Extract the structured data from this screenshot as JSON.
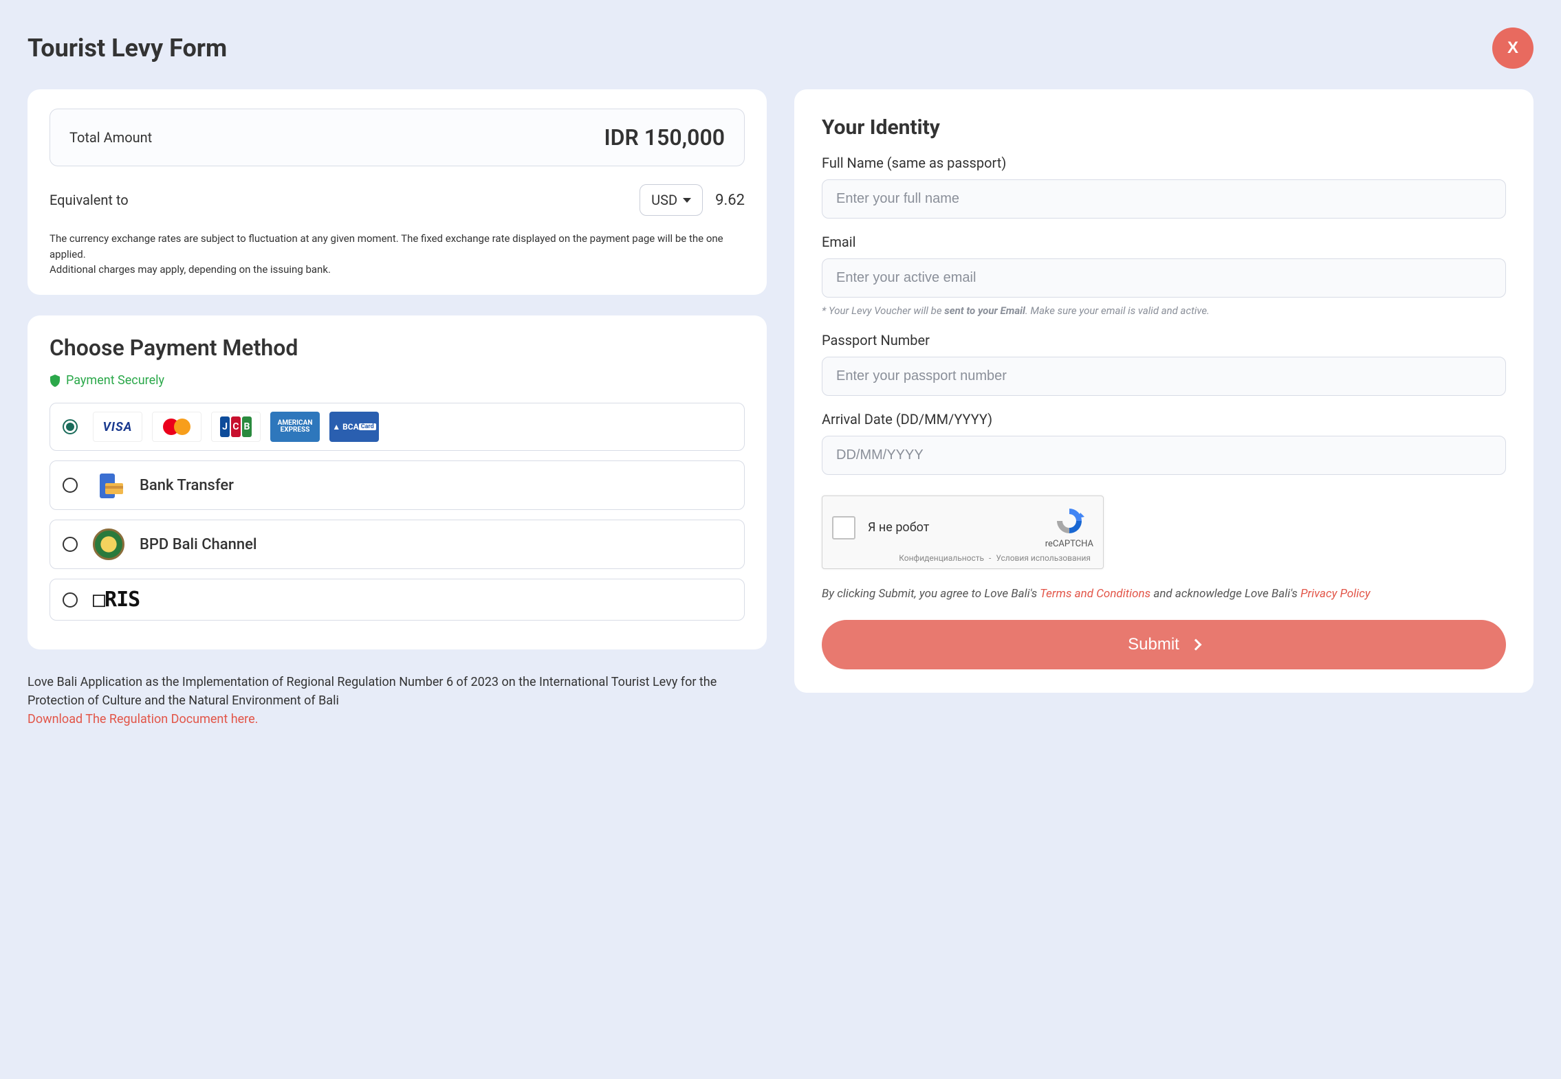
{
  "page_title": "Tourist Levy Form",
  "close_label": "X",
  "amount": {
    "label": "Total Amount",
    "value": "IDR 150,000",
    "equiv_label": "Equivalent to",
    "currency_selected": "USD",
    "equiv_value": "9.62",
    "disclaimer_1": "The currency exchange rates are subject to fluctuation at any given moment. The fixed exchange rate displayed on the payment page will be the one applied.",
    "disclaimer_2": "Additional charges may apply, depending on the issuing bank."
  },
  "payment": {
    "title": "Choose Payment Method",
    "secure_label": "Payment Securely",
    "options": [
      {
        "id": "cards",
        "selected": true,
        "label": "",
        "logos": [
          "VISA",
          "mastercard",
          "JCB",
          "AMERICAN EXPRESS",
          "BCA Card"
        ]
      },
      {
        "id": "bank-transfer",
        "selected": false,
        "label": "Bank Transfer"
      },
      {
        "id": "bpd-bali",
        "selected": false,
        "label": "BPD Bali Channel"
      },
      {
        "id": "qris",
        "selected": false,
        "label": "QRIS"
      }
    ]
  },
  "footer": {
    "text": "Love Bali Application as the Implementation of Regional Regulation Number 6 of 2023 on the International Tourist Levy for the Protection of Culture and the Natural Environment of Bali",
    "link_text": "Download The Regulation Document here."
  },
  "identity": {
    "title": "Your Identity",
    "fullname_label": "Full Name (same as passport)",
    "fullname_placeholder": "Enter your full name",
    "email_label": "Email",
    "email_placeholder": "Enter your active email",
    "email_note_prefix": "* Your Levy Voucher will be ",
    "email_note_bold": "sent to your Email",
    "email_note_suffix": ". Make sure your email is valid and active.",
    "passport_label": "Passport Number",
    "passport_placeholder": "Enter your passport number",
    "arrival_label": "Arrival Date (DD/MM/YYYY)",
    "arrival_placeholder": "DD/MM/YYYY"
  },
  "recaptcha": {
    "text": "Я не робот",
    "brand": "reCAPTCHA",
    "privacy": "Конфиденциальность",
    "terms": "Условия использования"
  },
  "agree": {
    "prefix": "By clicking Submit, you agree to Love Bali's ",
    "terms": "Terms and Conditions",
    "middle": " and acknowledge Love Bali's ",
    "privacy": "Privacy Policy"
  },
  "submit_label": "Submit"
}
